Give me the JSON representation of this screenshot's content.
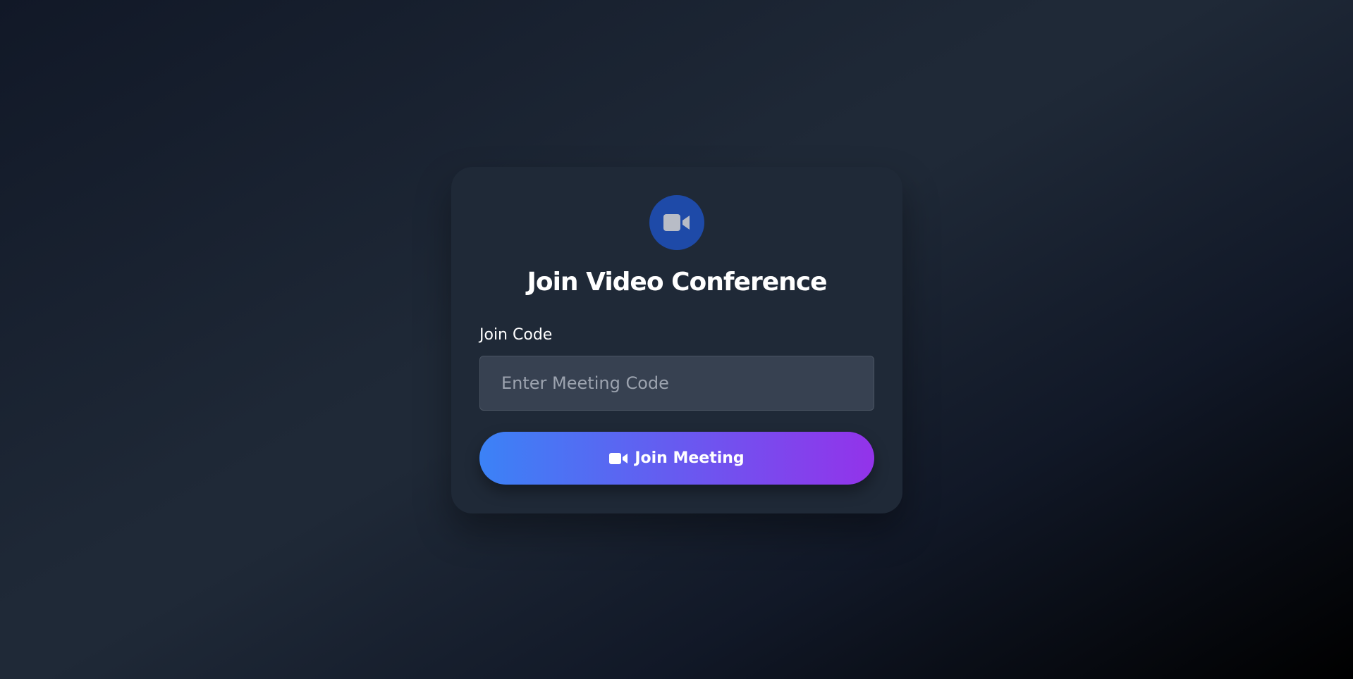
{
  "join_card": {
    "header_icon": "video-camera-icon",
    "title": "Join Video Conference",
    "join_code_label": "Join Code",
    "join_code_placeholder": "Enter Meeting Code",
    "join_code_value": "",
    "join_button_icon": "video-camera-icon",
    "join_button_label": "Join Meeting"
  },
  "colors": {
    "accent_gradient_start": "#3b82f6",
    "accent_gradient_end": "#9333ea",
    "icon_circle": "#1e4aa8",
    "card_background": "#1f2937"
  }
}
